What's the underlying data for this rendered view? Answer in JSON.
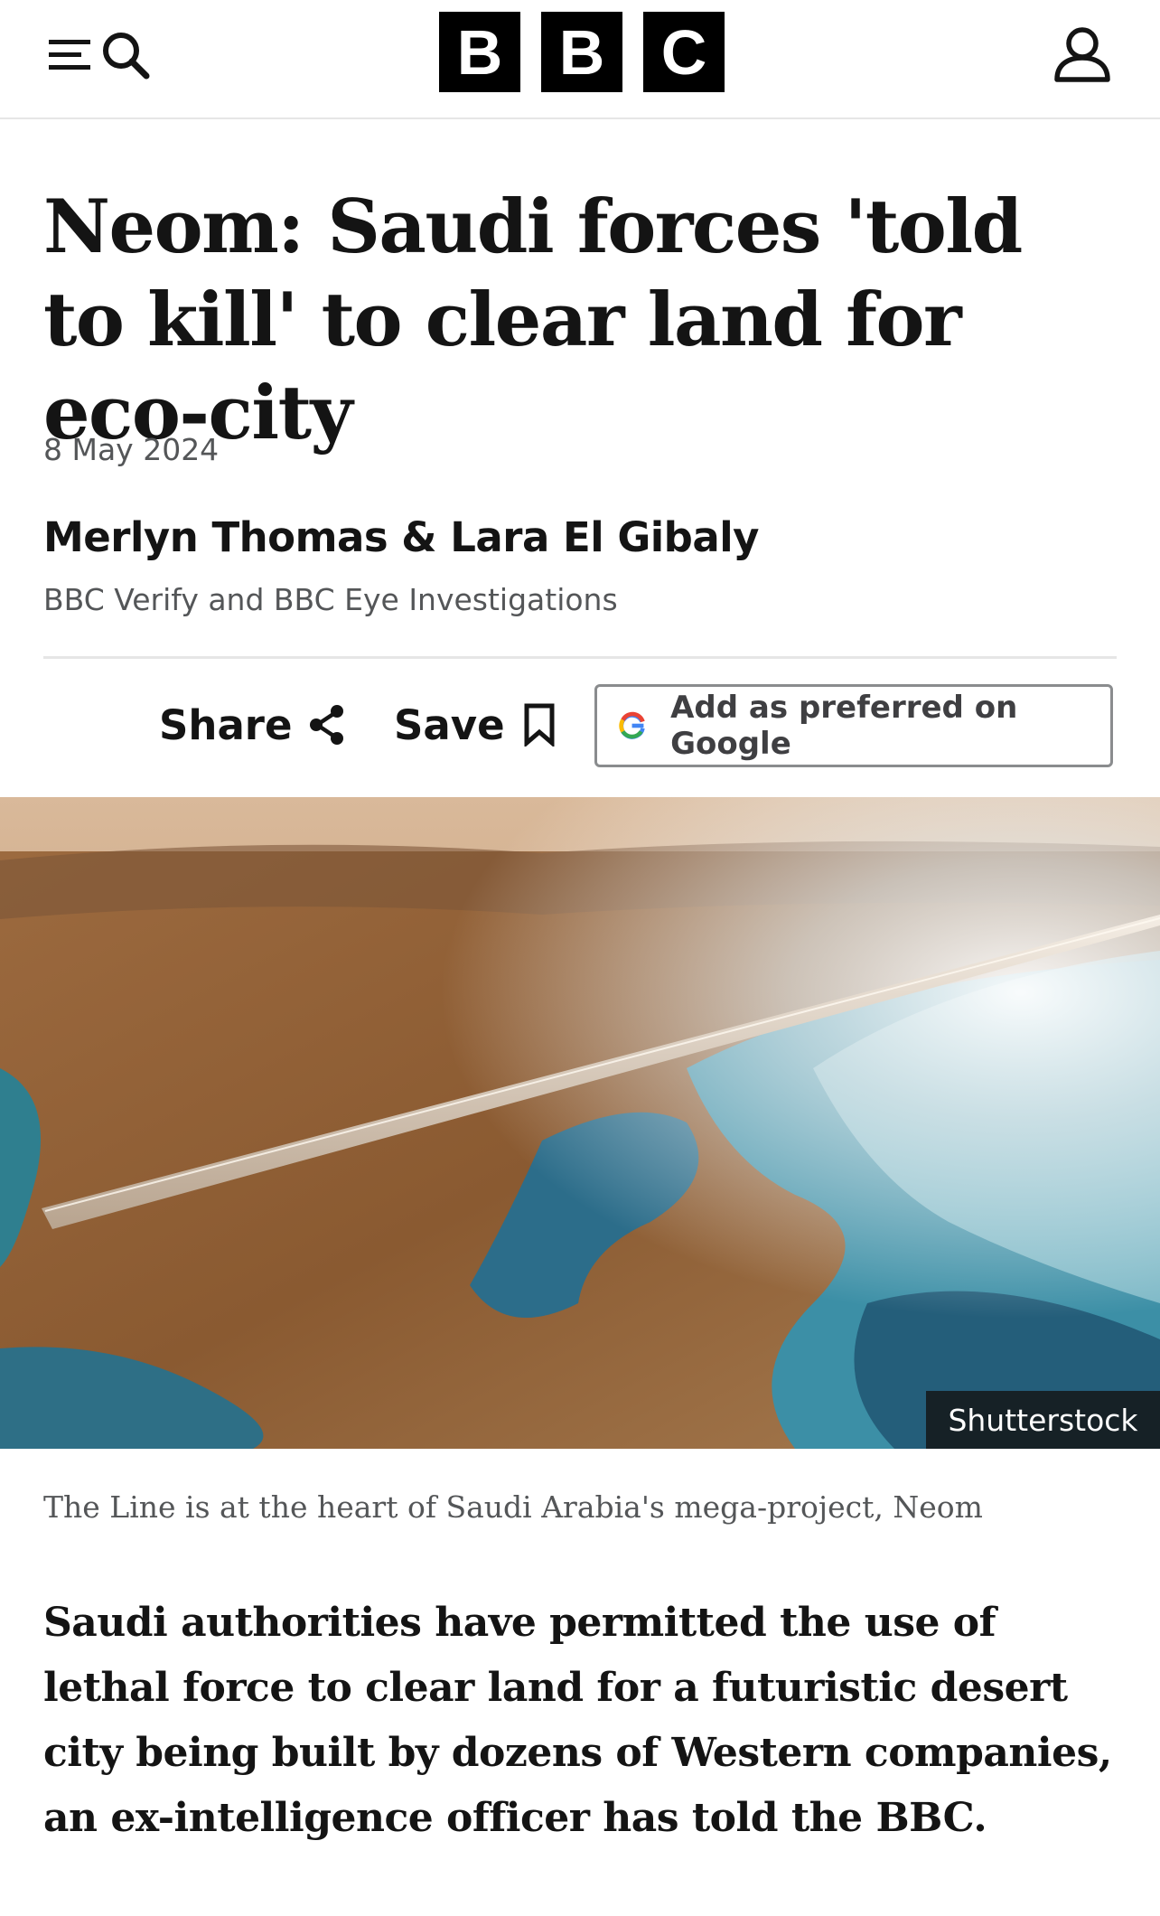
{
  "header": {
    "menu_icon": "menu-icon",
    "search_icon": "search-icon",
    "logo_letters": [
      "B",
      "B",
      "C"
    ],
    "account_icon": "account-icon"
  },
  "article": {
    "headline": "Neom: Saudi forces 'told to kill' to clear land for eco-city",
    "date": "8 May 2024",
    "authors": "Merlyn Thomas & Lara El Gibaly",
    "department": "BBC Verify and BBC Eye Investigations",
    "lead": "Saudi authorities have permitted the use of lethal force to clear land for a futuristic desert city being built by dozens of Western companies, an ex-intelligence officer has told the BBC."
  },
  "actions": {
    "share_label": "Share",
    "save_label": "Save",
    "google_label": "Add as preferred on Google"
  },
  "image": {
    "credit": "Shutterstock",
    "caption": "The Line is at the heart of Saudi Arabia's mega-project, Neom"
  },
  "colors": {
    "text": "#141414",
    "muted": "#545658",
    "divider": "#e6e6e6",
    "logo_bg": "#000000"
  }
}
